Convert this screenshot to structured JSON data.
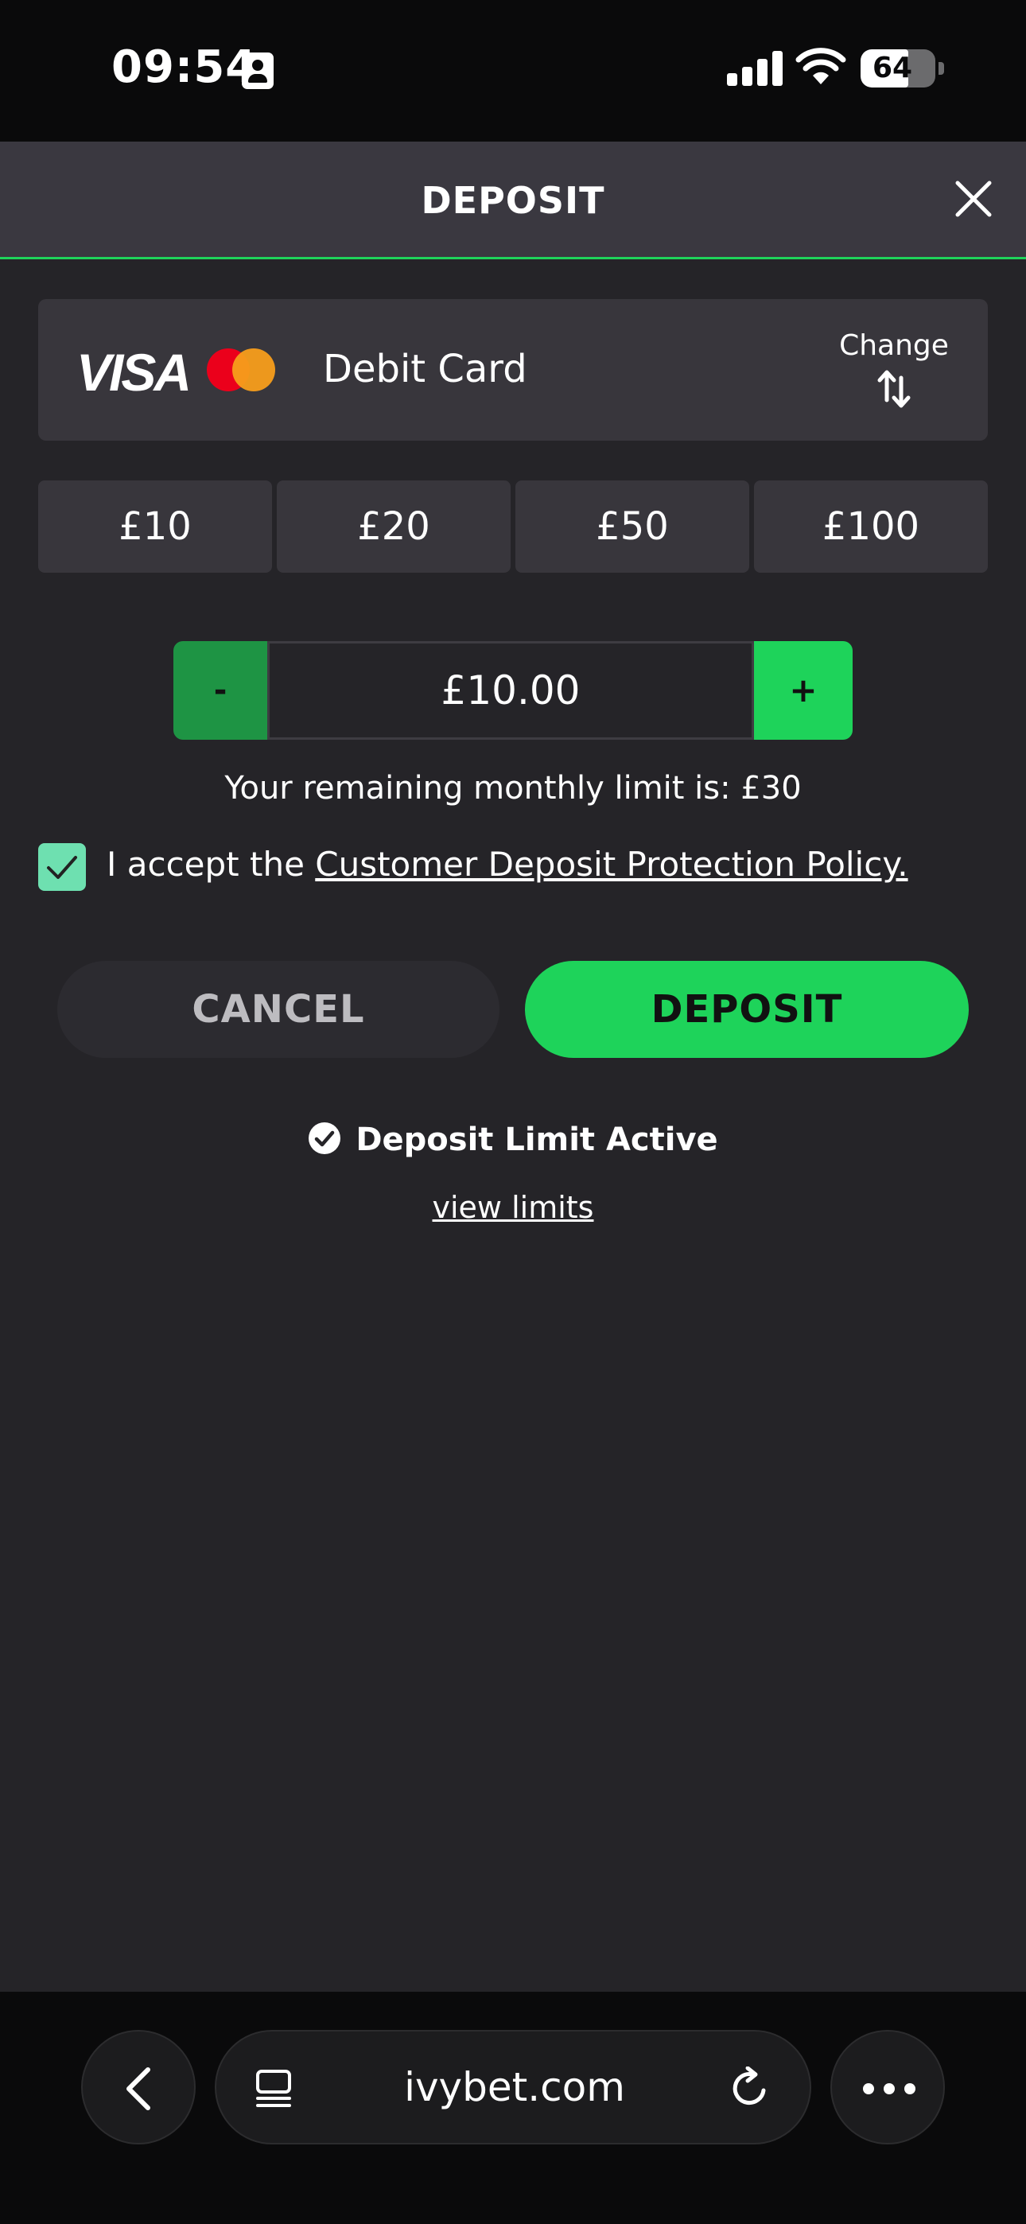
{
  "status": {
    "time": "09:54",
    "battery": "64",
    "battery_level": 0.64
  },
  "header": {
    "title": "DEPOSIT"
  },
  "payment": {
    "brand": "VISA",
    "label": "Debit Card",
    "change_label": "Change"
  },
  "quick_amounts": [
    "£10",
    "£20",
    "£50",
    "£100"
  ],
  "stepper": {
    "minus": "-",
    "value": "£10.00",
    "plus": "+"
  },
  "limit_text": "Your remaining monthly limit is: £30",
  "accept": {
    "prefix": "I accept the ",
    "link": "Customer Deposit Protection Policy.",
    "checked": true
  },
  "actions": {
    "cancel": "CANCEL",
    "deposit": "DEPOSIT"
  },
  "limit_status": {
    "label": "Deposit Limit Active",
    "link": "view limits"
  },
  "browser": {
    "url": "ivybet.com"
  },
  "colors": {
    "accent": "#1ed35a",
    "accent_dark": "#1e9444",
    "checkbox": "#6ee0b0",
    "panel": "#252428",
    "card": "#38363c"
  }
}
